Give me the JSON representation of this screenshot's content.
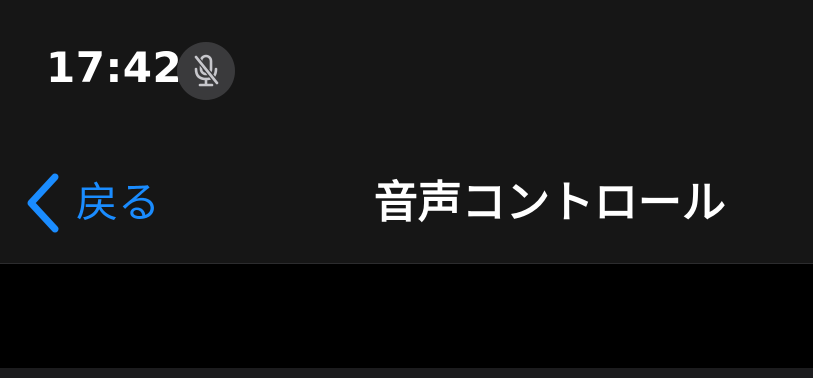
{
  "status_bar": {
    "time": "17:42",
    "mic_icon": "mic-slash-icon"
  },
  "nav_bar": {
    "back_label": "戻る",
    "back_icon": "chevron-left-icon",
    "title": "音声コントロール"
  },
  "colors": {
    "background": "#000000",
    "header_background": "#161616",
    "accent": "#1a8cff",
    "title_text": "#ffffff",
    "mic_pill": "#3a3a3c"
  }
}
